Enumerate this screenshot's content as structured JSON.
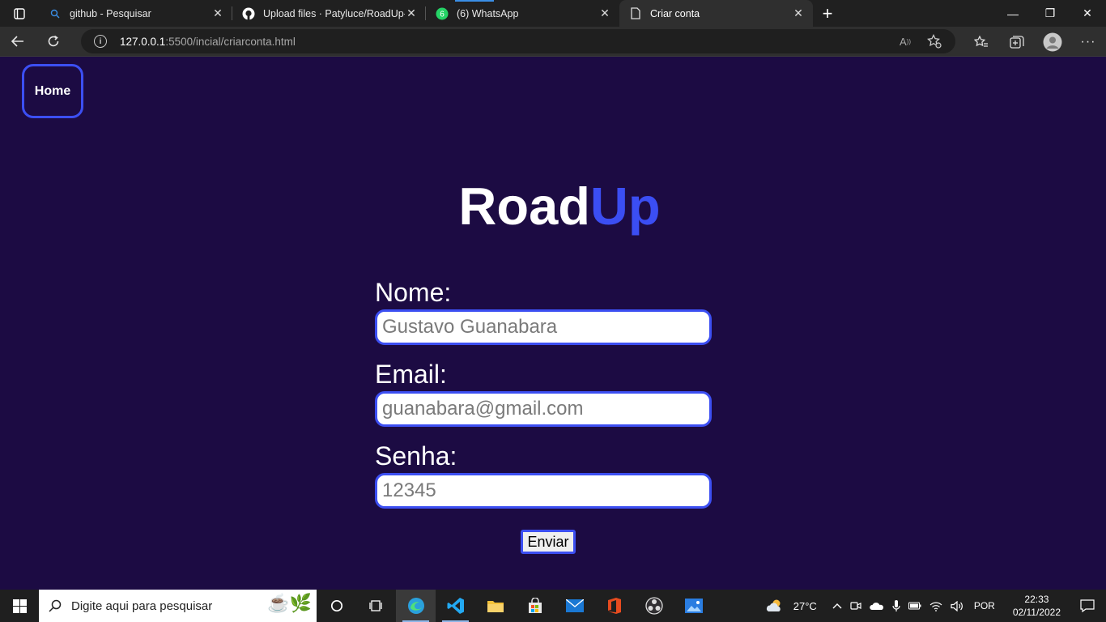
{
  "browser": {
    "tabs": [
      {
        "title": "github - Pesquisar",
        "icon": "search-icon"
      },
      {
        "title": "Upload files · Patyluce/RoadUp-",
        "icon": "github-icon"
      },
      {
        "title": "(6) WhatsApp",
        "icon": "whatsapp-icon",
        "badge": "6"
      },
      {
        "title": "Criar conta",
        "icon": "page-icon",
        "active": true
      }
    ],
    "url_host": "127.0.0.1",
    "url_path": ":5500/incial/criarconta.html"
  },
  "page": {
    "home_label": "Home",
    "logo_part1": "Road",
    "logo_part2": "Up",
    "fields": [
      {
        "label": "Nome:",
        "value": "Gustavo Guanabara"
      },
      {
        "label": "Email:",
        "value": "guanabara@gmail.com"
      },
      {
        "label": "Senha:",
        "value": "12345"
      }
    ],
    "submit_label": "Enviar"
  },
  "taskbar": {
    "search_placeholder": "Digite aqui para pesquisar",
    "weather": "27°C",
    "language": "POR",
    "time": "22:33",
    "date": "02/11/2022"
  },
  "colors": {
    "page_bg": "#1c0b43",
    "accent": "#3c4ff2"
  }
}
